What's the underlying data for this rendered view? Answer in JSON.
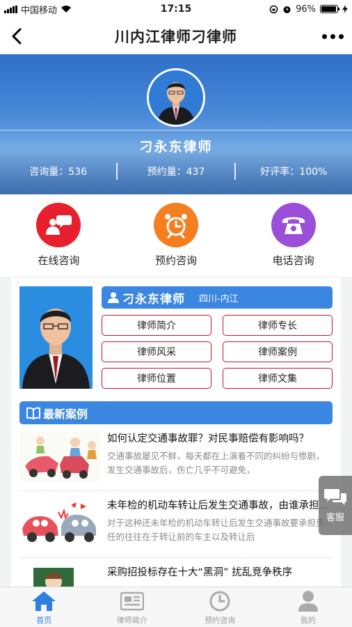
{
  "status_bar": {
    "carrier": "中国移动",
    "time": "17:15",
    "battery": "96%",
    "battery_level": 0.96
  },
  "nav": {
    "title": "川内江律师刁律师"
  },
  "banner": {
    "lawyer_name": "刁永东律师",
    "stats": [
      {
        "label": "咨询量",
        "value": "536",
        "text": "咨询量：536"
      },
      {
        "label": "预约量",
        "value": "437",
        "text": "预约量：437"
      },
      {
        "label": "好评率",
        "value": "100%",
        "text": "好评率：100%"
      }
    ]
  },
  "quick_actions": [
    {
      "label": "在线咨询",
      "icon": "chat-bubble-icon",
      "color": "#e8202e"
    },
    {
      "label": "预约咨询",
      "icon": "alarm-clock-icon",
      "color": "#f57e20"
    },
    {
      "label": "电话咨询",
      "icon": "telephone-icon",
      "color": "#9b4fd8"
    }
  ],
  "profile": {
    "name": "刁永东律师",
    "region": "四川-内江",
    "buttons": [
      "律师简介",
      "律师专长",
      "律师风采",
      "律师案例",
      "律师位置",
      "律师文集"
    ]
  },
  "cases_section": {
    "title": "最新案例",
    "items": [
      {
        "title": "如何认定交通事故罪？对民事赔偿有影响吗？",
        "desc": "交通事故屡见不鲜，每天都在上演着不同的纠纷与惨剧，发生交通事故后，伤亡几乎不可避免，"
      },
      {
        "title": "未年检的机动车转让后发生交通事故，由谁承担责任？",
        "desc": "对于这种还未年检的机动车转让后发生交通事故要承担责任的往往在于转让前的车主以及转让后"
      },
      {
        "title": "采购招投标存在十大“黑洞” 扰乱竞争秩序",
        "desc": ""
      }
    ]
  },
  "float_service": {
    "label": "客服"
  },
  "tabbar": {
    "items": [
      {
        "label": "首页",
        "active": true
      },
      {
        "label": "律师简介",
        "active": false
      },
      {
        "label": "预约咨询",
        "active": false
      },
      {
        "label": "我的",
        "active": false
      }
    ]
  },
  "colors": {
    "accent": "#3a86e0",
    "button_border": "#c8102e",
    "tab_active": "#2f7fe0"
  }
}
